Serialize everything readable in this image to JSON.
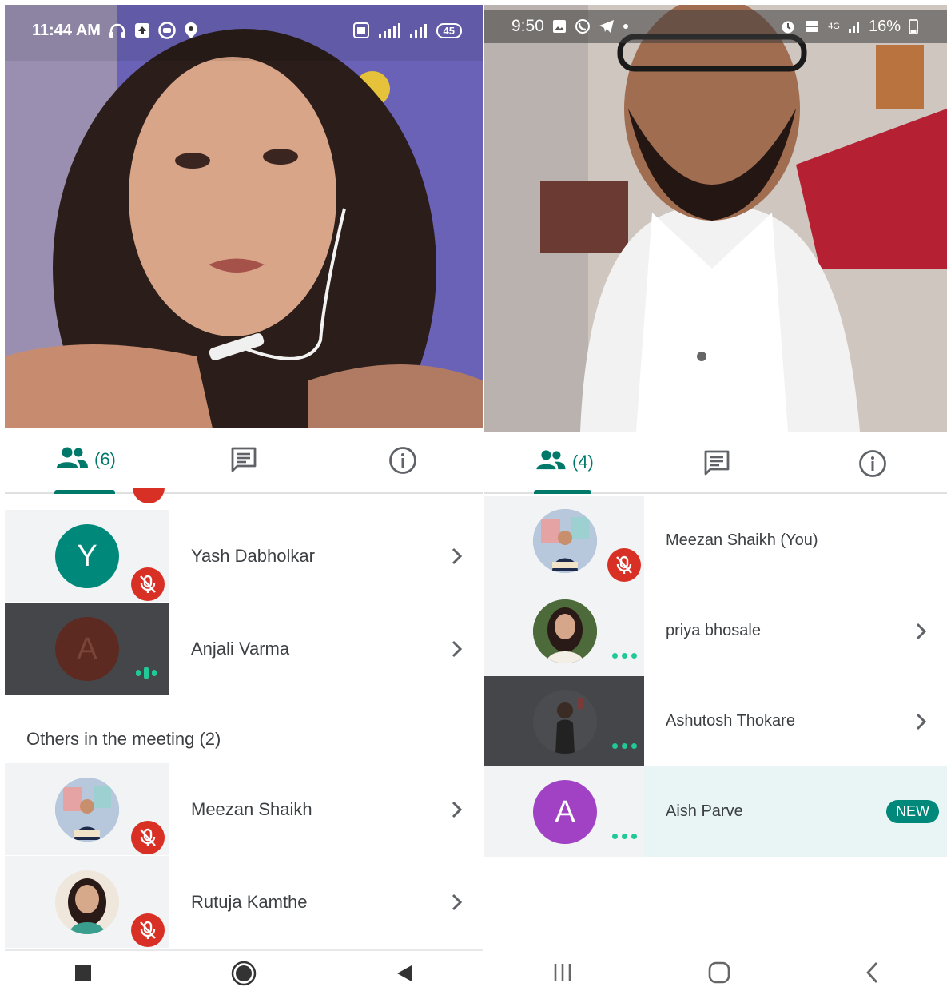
{
  "left": {
    "status": {
      "time": "11:44 AM",
      "battery": "45"
    },
    "tabs": {
      "people_count": "(6)"
    },
    "participants": [
      {
        "name": "Yash Dabholkar",
        "initial": "Y",
        "avatar_color": "#00897b",
        "state": "muted"
      },
      {
        "name": "Anjali Varma",
        "initial": "A",
        "avatar_color": "#5d2a22",
        "state": "speaking"
      }
    ],
    "others_label": "Others in the meeting (2)",
    "others": [
      {
        "name": "Meezan Shaikh",
        "state": "muted"
      },
      {
        "name": "Rutuja Kamthe",
        "state": "muted"
      }
    ]
  },
  "right": {
    "status": {
      "time": "9:50",
      "battery": "16%",
      "network": "4G"
    },
    "tabs": {
      "people_count": "(4)"
    },
    "participants": [
      {
        "name": "Meezan Shaikh (You)",
        "state": "muted"
      },
      {
        "name": "priya bhosale",
        "state": "idle"
      },
      {
        "name": "Ashutosh Thokare",
        "state": "idle"
      },
      {
        "name": "Aish Parve",
        "initial": "A",
        "avatar_color": "#a142c4",
        "state": "idle",
        "badge": "NEW"
      }
    ]
  },
  "colors": {
    "accent": "#00796b",
    "muted": "#d93025",
    "dots": "#20c997",
    "new_row": "#e8f5f4"
  }
}
